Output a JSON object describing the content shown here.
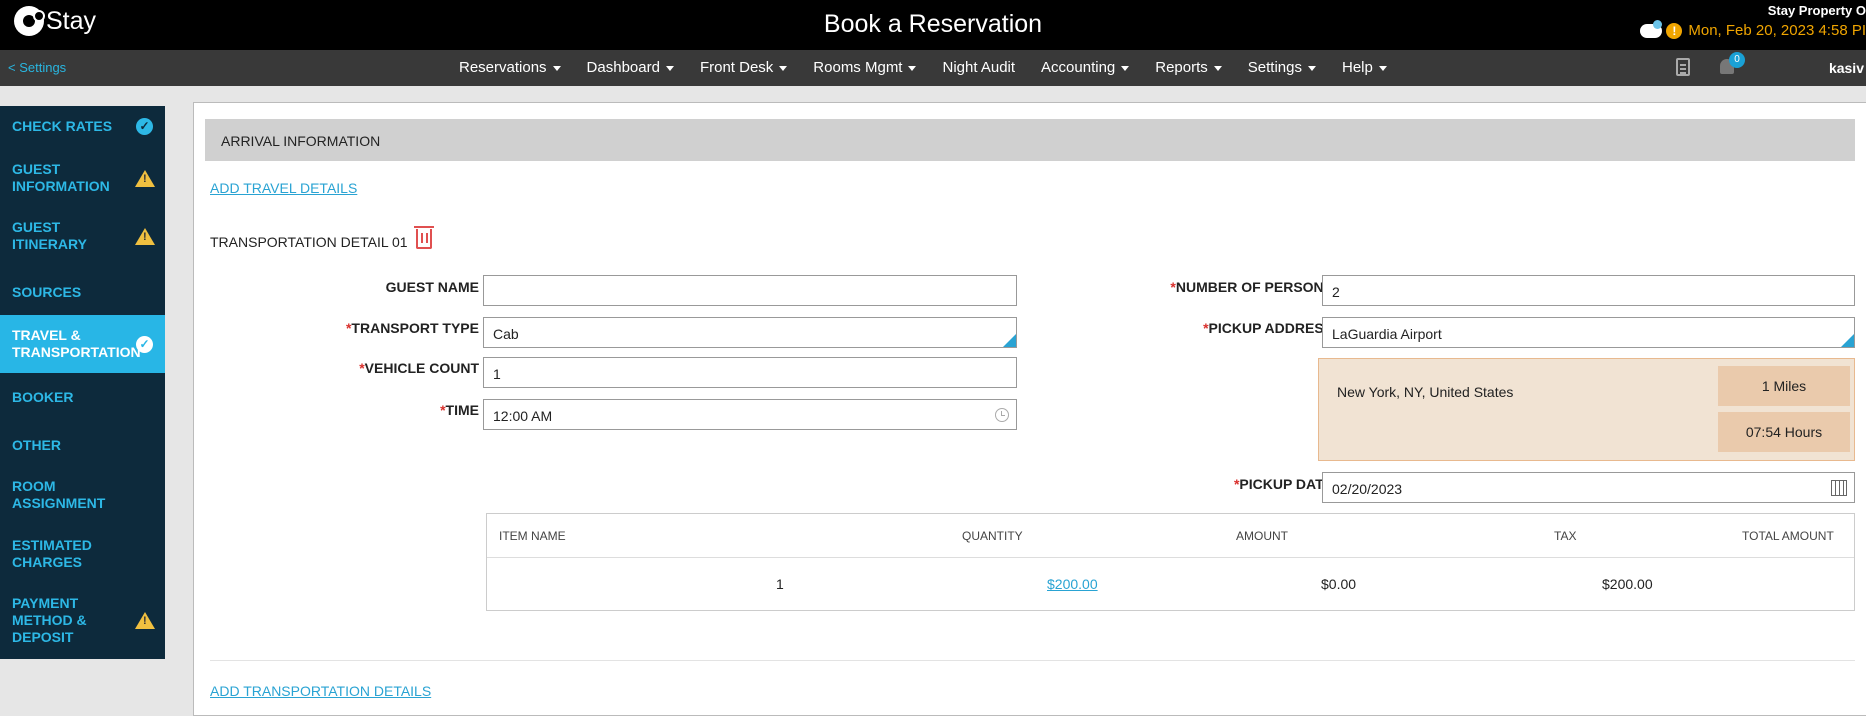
{
  "header": {
    "logo_text": "Stay",
    "title": "Book a Reservation",
    "property_name": "Stay Property O",
    "datetime": "Mon, Feb 20, 2023 4:58 PI",
    "warning_mark": "!"
  },
  "navbar": {
    "back_label": "<  Settings",
    "menu": [
      {
        "label": "Reservations"
      },
      {
        "label": "Dashboard"
      },
      {
        "label": "Front Desk"
      },
      {
        "label": "Rooms Mgmt"
      },
      {
        "label": "Night Audit"
      },
      {
        "label": "Accounting"
      },
      {
        "label": "Reports"
      },
      {
        "label": "Settings"
      },
      {
        "label": "Help"
      }
    ],
    "notification_count": "0",
    "user": "kasiv"
  },
  "sidebar": {
    "items": [
      {
        "label": "CHECK RATES",
        "status": "done"
      },
      {
        "label": "GUEST INFORMATION",
        "status": "warning"
      },
      {
        "label": "GUEST ITINERARY",
        "status": "warning"
      },
      {
        "label": "SOURCES",
        "status": ""
      },
      {
        "label": "TRAVEL & TRANSPORTATION",
        "status": "done"
      },
      {
        "label": "BOOKER",
        "status": ""
      },
      {
        "label": "OTHER",
        "status": ""
      },
      {
        "label": "ROOM ASSIGNMENT",
        "status": ""
      },
      {
        "label": "ESTIMATED CHARGES",
        "status": ""
      },
      {
        "label": "PAYMENT METHOD & DEPOSIT",
        "status": "warning"
      }
    ],
    "check_glyph": "✓",
    "warning_glyph": "!"
  },
  "main": {
    "section_title": "ARRIVAL INFORMATION",
    "add_travel_link": "ADD TRAVEL DETAILS",
    "detail_title": "TRANSPORTATION DETAIL 01",
    "fields": {
      "guest_name": {
        "label": "GUEST NAME",
        "value": ""
      },
      "transport_type": {
        "label": "TRANSPORT TYPE",
        "value": "Cab"
      },
      "vehicle_count": {
        "label": "VEHICLE COUNT",
        "value": "1"
      },
      "time": {
        "label": "TIME",
        "value": "12:00 AM"
      },
      "number_of_persons": {
        "label": "NUMBER OF PERSONS",
        "value": "2"
      },
      "pickup_address": {
        "label": "PICKUP ADDRESS",
        "value": "LaGuardia Airport"
      },
      "pickup_date": {
        "label": "PICKUP DATE",
        "value": "02/20/2023"
      }
    },
    "required_mark": "*",
    "address_info": {
      "location": "New York, NY, United States",
      "distance": "1 Miles",
      "duration": "07:54 Hours"
    },
    "items_table": {
      "columns": [
        "ITEM NAME",
        "QUANTITY",
        "AMOUNT",
        "TAX",
        "TOTAL AMOUNT"
      ],
      "rows": [
        {
          "quantity": "1",
          "amount": "$200.00",
          "tax": "$0.00",
          "total": "$200.00"
        }
      ]
    },
    "add_transport_link": "ADD TRANSPORTATION DETAILS"
  },
  "colors": {
    "accent": "#29b6e6",
    "sidebar_bg": "#0d2a3c",
    "warning": "#f0a500",
    "required": "#d9302c"
  }
}
